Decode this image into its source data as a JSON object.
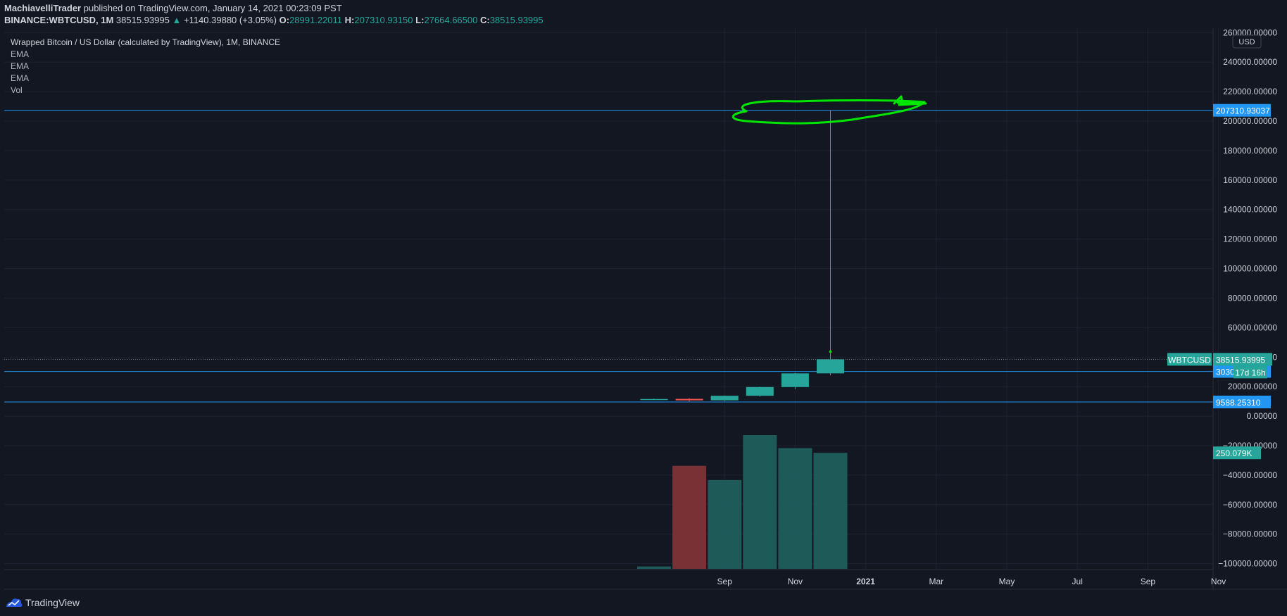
{
  "header": {
    "line1": {
      "author": "MachiavelliTrader",
      "text": " published on TradingView.com, January 14, 2021 00:23:09 PST"
    },
    "line2": {
      "symbol": "BINANCE:WBTCUSD",
      "interval": ", 1M",
      "price": "38515.93995",
      "arrow": "▲",
      "change": "+1140.39880 (+3.05%)",
      "o_label": "O:",
      "o_value": "28991.22011",
      "h_label": "H:",
      "h_value": "207310.93150",
      "l_label": "L:",
      "l_value": "27664.66500",
      "c_label": "C:",
      "c_value": "38515.93995"
    }
  },
  "legend": {
    "title": "Wrapped Bitcoin / US Dollar (calculated by TradingView), 1M, BINANCE",
    "indicators": [
      "EMA",
      "EMA",
      "EMA",
      "Vol"
    ]
  },
  "footer": {
    "brand": "TradingView",
    "logo_icon": "tradingview-logo-icon"
  },
  "colors": {
    "background": "#131722",
    "grid": "#1e2230",
    "text": "#d1d4dc",
    "up": "#26a69a",
    "down": "#ef5350",
    "vol_up": "#1f5e5c",
    "vol_down": "#7e3338",
    "hline": "#2962ff",
    "hline_label": "#2196f3",
    "annotation": "#00e600"
  },
  "chart_data": {
    "type": "candlestick",
    "title": "Wrapped Bitcoin / US Dollar (calculated by TradingView), 1M, BINANCE",
    "currency": "USD",
    "y_axis_ticks": [
      260000,
      240000,
      220000,
      200000,
      180000,
      160000,
      140000,
      120000,
      100000,
      80000,
      60000,
      40000,
      20000,
      0,
      -20000,
      -40000,
      -60000,
      -80000,
      -100000
    ],
    "y_tick_labels": [
      "260000.00000",
      "240000.00000",
      "220000.00000",
      "200000.00000",
      "180000.00000",
      "160000.00000",
      "140000.00000",
      "120000.00000",
      "100000.00000",
      "80000.00000",
      "60000.00000",
      "40000.00000",
      "20000.00000",
      "0.00000",
      "−20000.00000",
      "−40000.00000",
      "−60000.00000",
      "−80000.00000",
      "−100000.00000"
    ],
    "ylim": [
      -104000,
      263000
    ],
    "x_axis_labels": [
      {
        "label": "Sep",
        "month_index": 2
      },
      {
        "label": "Nov",
        "month_index": 4
      },
      {
        "label": "2021",
        "month_index": 6,
        "bold": true
      },
      {
        "label": "Mar",
        "month_index": 8
      },
      {
        "label": "May",
        "month_index": 10
      },
      {
        "label": "Jul",
        "month_index": 12
      },
      {
        "label": "Sep",
        "month_index": 14
      },
      {
        "label": "Nov",
        "month_index": 16
      }
    ],
    "candles": [
      {
        "month_index": 0,
        "open": 11300,
        "high": 11900,
        "low": 11000,
        "close": 11600
      },
      {
        "month_index": 1,
        "open": 11700,
        "high": 12200,
        "low": 9900,
        "close": 10700
      },
      {
        "month_index": 2,
        "open": 10700,
        "high": 14000,
        "low": 10200,
        "close": 13800
      },
      {
        "month_index": 3,
        "open": 13800,
        "high": 19900,
        "low": 13200,
        "close": 19700
      },
      {
        "month_index": 4,
        "open": 19700,
        "high": 29300,
        "low": 18300,
        "close": 28990
      },
      {
        "month_index": 5,
        "open": 28991.22011,
        "high": 207310.9315,
        "low": 27664.665,
        "close": 38515.93995
      }
    ],
    "volume": [
      {
        "month_index": 0,
        "value": 4,
        "direction": "up"
      },
      {
        "month_index": 1,
        "value": 174,
        "direction": "down"
      },
      {
        "month_index": 2,
        "value": 150,
        "direction": "up"
      },
      {
        "month_index": 3,
        "value": 226,
        "direction": "up"
      },
      {
        "month_index": 4,
        "value": 204,
        "direction": "up"
      },
      {
        "month_index": 5,
        "value": 196,
        "direction": "up"
      }
    ],
    "volume_max": 226,
    "horizontal_lines": [
      {
        "value": 207310.93037,
        "label": "207310.93037"
      },
      {
        "value": 30302.59033,
        "label": "30302.59033"
      },
      {
        "value": 9588.2531,
        "label": "9588.25310"
      }
    ],
    "last_price": {
      "value": 38515.93995,
      "label": "38515.93995",
      "symbol": "WBTCUSD",
      "countdown": "17d 16h"
    },
    "volume_last_label": "250.079K",
    "annotation": {
      "type": "freehand-ellipse",
      "color": "#00e600",
      "around": "wick high"
    }
  }
}
